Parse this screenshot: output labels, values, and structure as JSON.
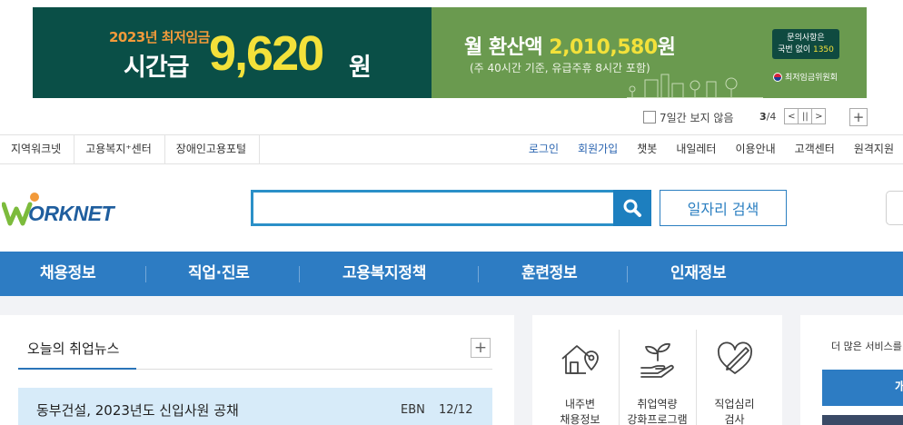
{
  "banner": {
    "year_label": "2023년 최저임금",
    "hourly_label": "시간급",
    "hourly_amount": "9,620",
    "won": "원",
    "month_prefix": "월 환산액 ",
    "month_amount": "2,010,580",
    "month_suffix": "원",
    "note": "(주 40시간 기준, 유급주휴 8시간 포함)",
    "inquiry_line1": "문의사항은",
    "inquiry_line2": "국번 없이 ",
    "inquiry_number": "1350",
    "org": "최저임금위원회"
  },
  "banner_controls": {
    "hide_week_label": "7일간 보지 않음",
    "page_current": "3",
    "page_total": "/4",
    "prev_glyph": "<",
    "pause_glyph": "||",
    "next_glyph": ">",
    "expand_glyph": "+"
  },
  "family_sites": [
    "지역워크넷",
    "고용복지⁺센터",
    "장애인고용포털"
  ],
  "gnb_links": [
    {
      "label": "로그인",
      "highlight": true
    },
    {
      "label": "회원가입",
      "highlight": true
    },
    {
      "label": "챗봇",
      "highlight": false
    },
    {
      "label": "내일레터",
      "highlight": false
    },
    {
      "label": "이용안내",
      "highlight": false
    },
    {
      "label": "고객센터",
      "highlight": false
    },
    {
      "label": "원격지원",
      "highlight": false
    }
  ],
  "header": {
    "logo_text": "ORKNET",
    "search_placeholder": "",
    "job_search_label": "일자리 검색"
  },
  "nav": [
    "채용정보",
    "직업·진로",
    "고용복지정책",
    "훈련정보",
    "인재정보"
  ],
  "news": {
    "title": "오늘의 취업뉴스",
    "more_glyph": "+",
    "items": [
      {
        "title": "동부건설, 2023년도 신입사원 공채",
        "source": "EBN",
        "date": "12/12"
      }
    ]
  },
  "services": [
    {
      "line1": "내주변",
      "line2": "채용정보",
      "icon": "house-pin-icon"
    },
    {
      "line1": "취업역량",
      "line2": "강화프로그램",
      "icon": "sprout-hand-icon"
    },
    {
      "line1": "직업심리",
      "line2": "검사",
      "icon": "heart-pen-icon"
    }
  ],
  "side": {
    "more_services": "더 많은 서비스를",
    "button_label": "개"
  },
  "colors": {
    "banner_left": "#0a4f47",
    "banner_right": "#6a9a4f",
    "accent_yellow": "#f3e13a",
    "nav_blue": "#2d7cc3",
    "search_border": "#2b90c8",
    "logo_orange": "#f29a3a"
  }
}
